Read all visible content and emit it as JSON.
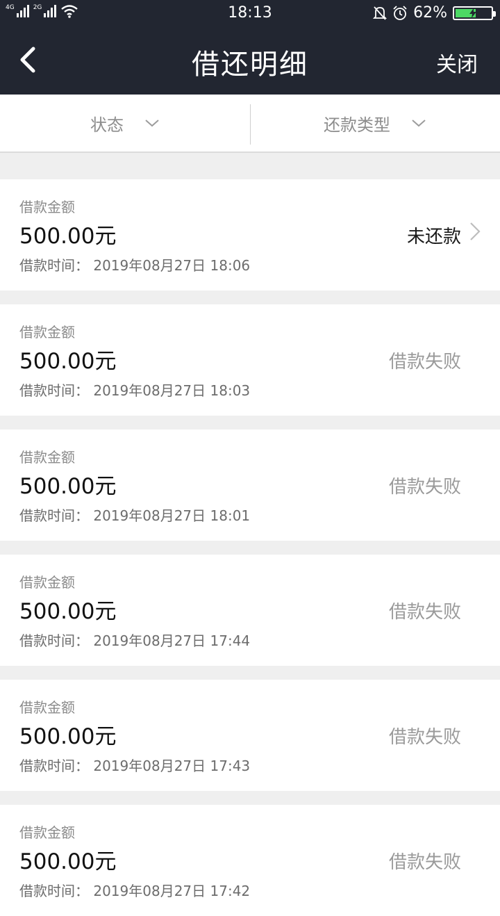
{
  "statusbar": {
    "net1": "4G",
    "net2": "2G",
    "time": "18:13",
    "battery_level": 0.62,
    "battery_text": "62%"
  },
  "navbar": {
    "title": "借还明细",
    "close_label": "关闭"
  },
  "filters": [
    {
      "label": "状态"
    },
    {
      "label": "还款类型"
    }
  ],
  "records": [
    {
      "amount_label": "借款金额",
      "amount": "500.00元",
      "time_label": "借款时间：",
      "time": "2019年08月27日 18:06",
      "status": "未还款"
    },
    {
      "amount_label": "借款金额",
      "amount": "500.00元",
      "time_label": "借款时间：",
      "time": "2019年08月27日 18:03",
      "status": "借款失败"
    },
    {
      "amount_label": "借款金额",
      "amount": "500.00元",
      "time_label": "借款时间：",
      "time": "2019年08月27日 18:01",
      "status": "借款失败"
    },
    {
      "amount_label": "借款金额",
      "amount": "500.00元",
      "time_label": "借款时间：",
      "time": "2019年08月27日 17:44",
      "status": "借款失败"
    },
    {
      "amount_label": "借款金额",
      "amount": "500.00元",
      "time_label": "借款时间：",
      "time": "2019年08月27日 17:43",
      "status": "借款失败"
    },
    {
      "amount_label": "借款金额",
      "amount": "500.00元",
      "time_label": "借款时间：",
      "time": "2019年08月27日 17:42",
      "status": "借款失败"
    }
  ],
  "colors": {
    "nav_bg": "#222631",
    "page_bg": "#efefef",
    "battery_fill": "#4cd964"
  },
  "icons": [
    "back-arrow-icon",
    "chevron-down-icon",
    "chevron-right-icon",
    "wifi-icon",
    "mute-bell-icon",
    "alarm-clock-icon",
    "battery-charging-icon"
  ]
}
